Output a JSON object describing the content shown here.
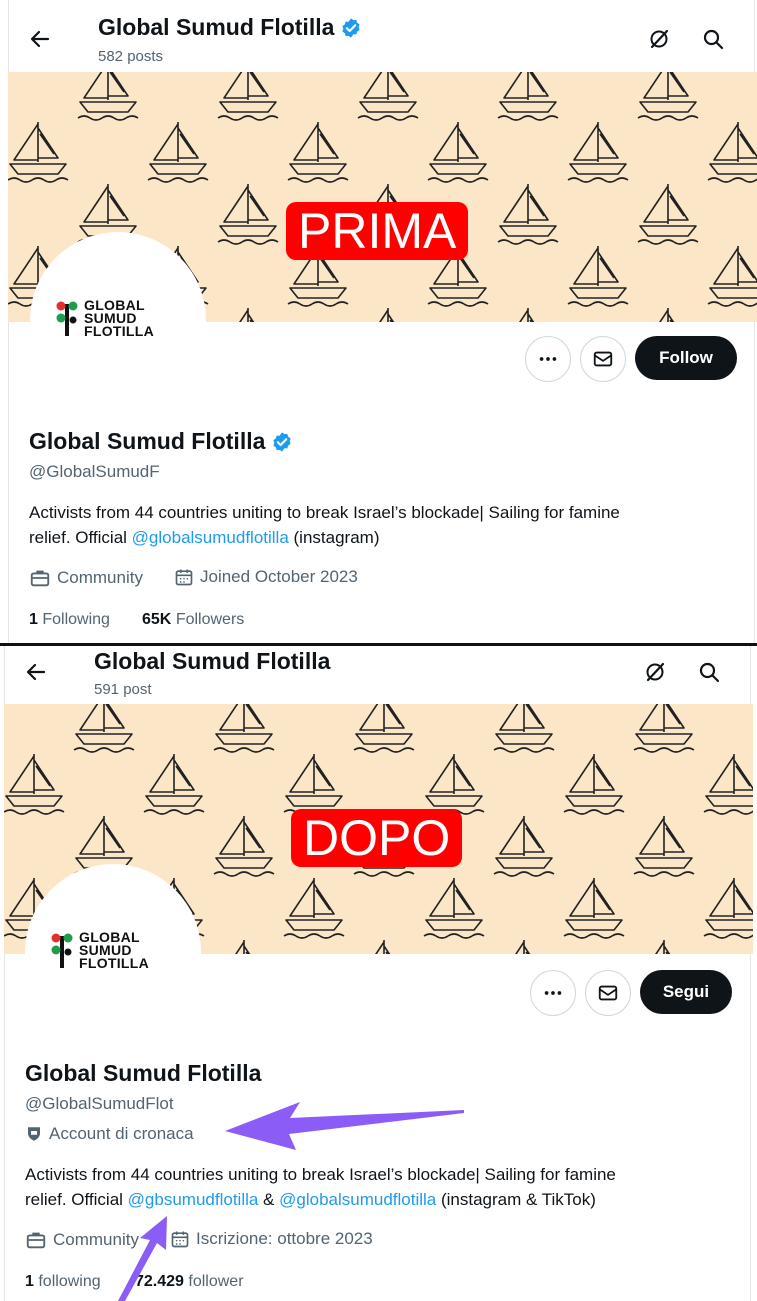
{
  "before": {
    "stamp": "PRIMA",
    "title": "Global Sumud Flotilla",
    "posts": "582 posts",
    "name": "Global Sumud Flotilla",
    "handle": "@GlobalSumudF",
    "bio_1": "Activists from 44 countries uniting to break Israel’s blockade| Sailing for famine",
    "bio_2a": "relief. Official ",
    "bio_link": "@globalsumudflotilla",
    "bio_2b": " (instagram)",
    "category": "Community",
    "joined": "Joined October 2023",
    "following_count": "1",
    "following_label": "Following",
    "followers_count": "65K",
    "followers_label": "Followers",
    "follow_label": "Follow"
  },
  "after": {
    "stamp": "DOPO",
    "title": "Global Sumud Flotilla",
    "posts": "591 post",
    "name": "Global Sumud Flotilla",
    "handle": "@GlobalSumudFlot",
    "label": "Account di cronaca",
    "bio_1": "Activists from 44 countries uniting to break Israel’s blockade| Sailing for famine",
    "bio_2a": "relief. Official ",
    "bio_link1": "@gbsumudflotilla",
    "bio_amp": " & ",
    "bio_link2": "@globalsumudflotilla",
    "bio_2b": " (instagram & TikTok)",
    "category": "Community",
    "joined": "Iscrizione: ottobre 2023",
    "following_count": "1",
    "following_label": "following",
    "followers_count": "72.429",
    "followers_label": "follower",
    "follow_label": "Segui"
  },
  "logo": {
    "line1": "GLOBAL",
    "line2": "SUMUD",
    "line3": "FLOTILLA"
  },
  "icons": [
    "back-arrow-icon",
    "grok-icon",
    "search-icon",
    "more-icon",
    "message-icon",
    "verified-badge-icon",
    "briefcase-icon",
    "calendar-icon",
    "news-label-icon"
  ],
  "colors": {
    "banner": "#fbe6c8",
    "stamp": "#ff0000",
    "link": "#1d9bf0",
    "verified": "#1d9bf0",
    "arrow": "#8b5cf6",
    "button": "#0f1419"
  }
}
